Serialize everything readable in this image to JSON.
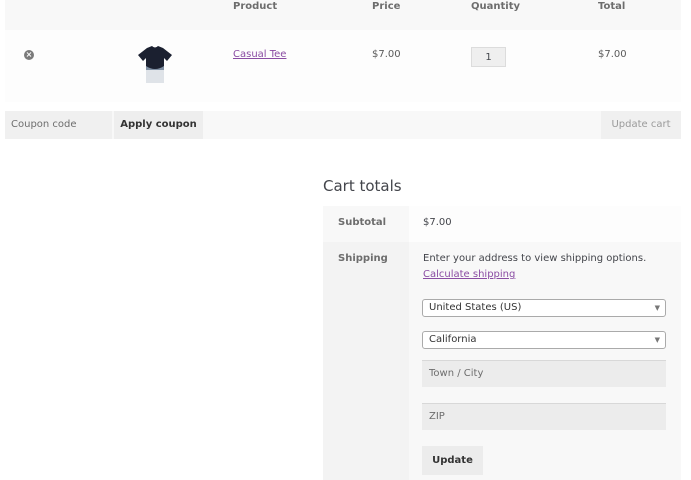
{
  "cart_table": {
    "headers": {
      "product": "Product",
      "price": "Price",
      "quantity": "Quantity",
      "total": "Total"
    },
    "rows": [
      {
        "remove_icon": "remove-circle-icon",
        "product_name": "Casual Tee",
        "price": "$7.00",
        "quantity": "1",
        "total": "$7.00"
      }
    ]
  },
  "coupon": {
    "placeholder": "Coupon code",
    "apply_label": "Apply coupon",
    "update_cart_label": "Update cart"
  },
  "cart_totals": {
    "title": "Cart totals",
    "subtotal_label": "Subtotal",
    "subtotal_value": "$7.00",
    "shipping_label": "Shipping",
    "shipping_message": "Enter your address to view shipping options.",
    "calculate_link": "Calculate shipping",
    "country_value": "United States (US)",
    "state_value": "California",
    "city_placeholder": "Town / City",
    "zip_placeholder": "ZIP",
    "update_label": "Update"
  },
  "colors": {
    "link": "#8a4ca3",
    "header_bg": "#f8f8f8"
  }
}
